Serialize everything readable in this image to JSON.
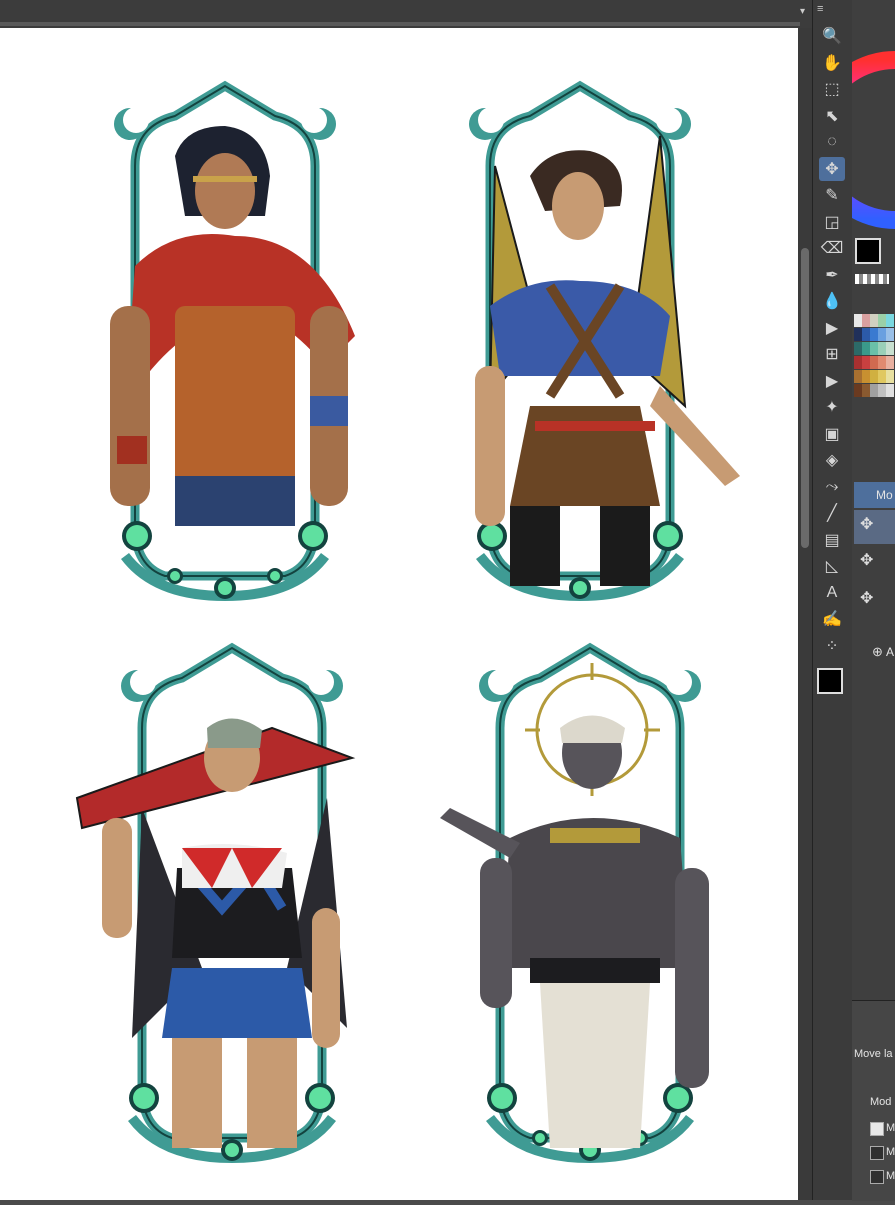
{
  "topbar": {
    "menu_glyph": "≡",
    "chevron": "▾"
  },
  "toolbar": {
    "tools": [
      {
        "name": "zoom-icon",
        "glyph": "🔍"
      },
      {
        "name": "hand-icon",
        "glyph": "✋"
      },
      {
        "name": "marquee-icon",
        "glyph": "⬚"
      },
      {
        "name": "object-select-icon",
        "glyph": "⬉"
      },
      {
        "name": "lasso-icon",
        "glyph": "◌"
      },
      {
        "name": "move-icon",
        "glyph": "✥"
      },
      {
        "name": "eyedropper-icon",
        "glyph": "✎"
      },
      {
        "name": "fill-bucket-icon",
        "glyph": "◲"
      },
      {
        "name": "eraser-icon",
        "glyph": "⌫"
      },
      {
        "name": "pen-icon",
        "glyph": "✒"
      },
      {
        "name": "blend-icon",
        "glyph": "💧"
      },
      {
        "name": "play-icon",
        "glyph": "▶"
      },
      {
        "name": "mesh-icon",
        "glyph": "⊞"
      },
      {
        "name": "play-alt-icon",
        "glyph": "▶"
      },
      {
        "name": "sparkle-icon",
        "glyph": "✦"
      },
      {
        "name": "gradient-icon",
        "glyph": "▣"
      },
      {
        "name": "paint-bucket-icon",
        "glyph": "◈"
      },
      {
        "name": "pipette-icon",
        "glyph": "⤳"
      },
      {
        "name": "line-icon",
        "glyph": "╱"
      },
      {
        "name": "panel-icon",
        "glyph": "▤"
      },
      {
        "name": "triangle-ruler-icon",
        "glyph": "◺"
      },
      {
        "name": "text-icon",
        "glyph": "A"
      },
      {
        "name": "brush-icon",
        "glyph": "✍"
      },
      {
        "name": "spray-icon",
        "glyph": "⁘"
      }
    ],
    "main_color": "#000000",
    "sub_color": "#ffffff"
  },
  "right_panel": {
    "tool_label_partial": "Mo",
    "add_label_partial": "A",
    "property_title": "Move la",
    "mode_label": "Mod",
    "checkbox_labels": [
      "M",
      "M",
      "M"
    ],
    "checkbox_states": [
      true,
      false,
      false
    ]
  },
  "colors": {
    "accent": "#4e6f9c",
    "frame_teal": "#3f9b94",
    "frame_dark": "#13433f",
    "orb_green": "#5fe0a0"
  },
  "palette": [
    "#e8e8e8",
    "#d9a0a0",
    "#d0d0c0",
    "#9ad0a8",
    "#7ad8e0",
    "#20305a",
    "#2c5aa8",
    "#3a7ad0",
    "#6aa0e0",
    "#9ac0e8",
    "#2c6a68",
    "#3a9a8a",
    "#6ac0a8",
    "#9ad0b8",
    "#c8e0d0",
    "#a83030",
    "#c84040",
    "#d06a50",
    "#e08a70",
    "#e8b0a0",
    "#a87030",
    "#c89030",
    "#d0b040",
    "#e0c860",
    "#e8e0a0",
    "#6a3a20",
    "#8a5a30",
    "#a0a0a0",
    "#c0c0c0",
    "#e0e0e0"
  ]
}
